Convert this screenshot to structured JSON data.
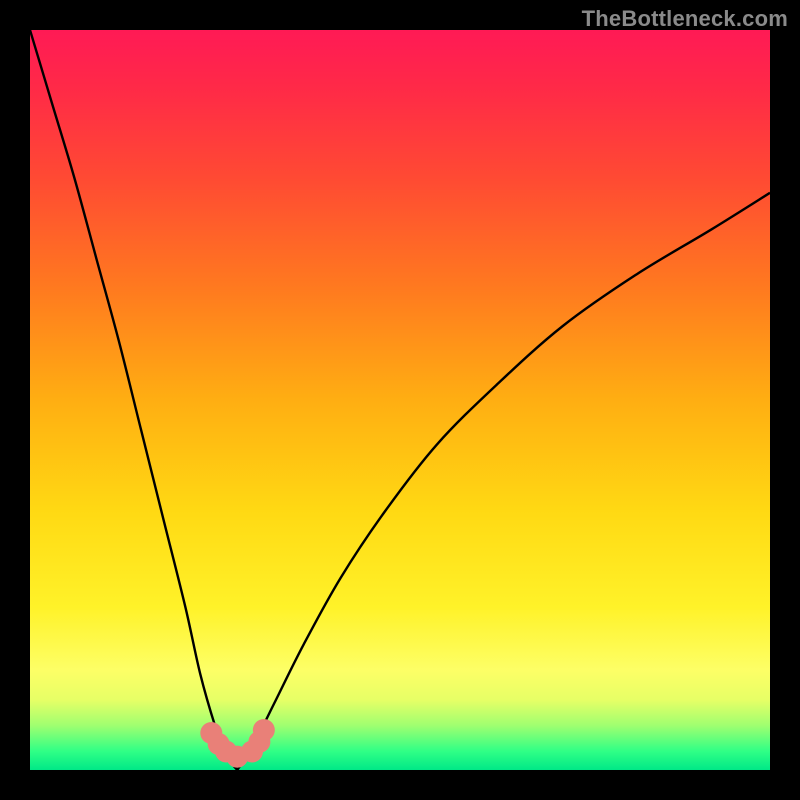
{
  "watermark": "TheBottleneck.com",
  "chart_data": {
    "type": "line",
    "title": "",
    "xlabel": "",
    "ylabel": "",
    "xlim": [
      0,
      100
    ],
    "ylim": [
      0,
      100
    ],
    "optimum_x": 28,
    "left_curve": {
      "x": [
        0,
        3,
        6,
        9,
        12,
        15,
        18,
        21,
        23,
        25,
        26.5,
        28
      ],
      "y": [
        100,
        90,
        80,
        69,
        58,
        46,
        34,
        22,
        13,
        6,
        2,
        0
      ]
    },
    "right_curve": {
      "x": [
        28,
        30,
        33,
        37,
        42,
        48,
        55,
        63,
        72,
        82,
        92,
        100
      ],
      "y": [
        0,
        3,
        9,
        17,
        26,
        35,
        44,
        52,
        60,
        67,
        73,
        78
      ]
    },
    "markers": {
      "x": [
        24.5,
        25.5,
        26.5,
        28.0,
        30.0,
        31.0,
        31.6
      ],
      "y": [
        5.0,
        3.5,
        2.5,
        1.8,
        2.5,
        3.8,
        5.4
      ]
    },
    "gradient_stops": [
      {
        "offset": 0.0,
        "color": "#ff1a55"
      },
      {
        "offset": 0.08,
        "color": "#ff2a47"
      },
      {
        "offset": 0.2,
        "color": "#ff4a33"
      },
      {
        "offset": 0.35,
        "color": "#ff7a1f"
      },
      {
        "offset": 0.5,
        "color": "#ffae12"
      },
      {
        "offset": 0.65,
        "color": "#ffd913"
      },
      {
        "offset": 0.78,
        "color": "#fff229"
      },
      {
        "offset": 0.865,
        "color": "#fdff66"
      },
      {
        "offset": 0.905,
        "color": "#e7ff66"
      },
      {
        "offset": 0.94,
        "color": "#9fff70"
      },
      {
        "offset": 0.975,
        "color": "#2fff86"
      },
      {
        "offset": 1.0,
        "color": "#00e887"
      }
    ],
    "marker_color": "#e98078",
    "curve_color": "#000000"
  }
}
